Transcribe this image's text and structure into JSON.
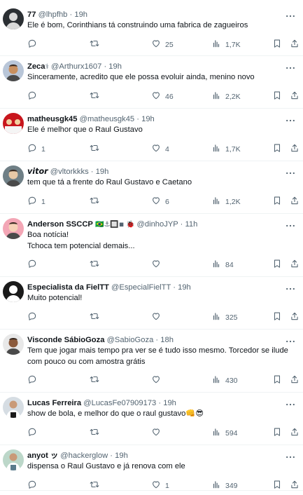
{
  "tweets": [
    {
      "display_name": "77",
      "handle": "@lhpfhb",
      "time": "19h",
      "text_lines": [
        "Ele é bom, Corinthians tá construindo uma fabrica de zagueiros"
      ],
      "replies": "",
      "retweets": "",
      "likes": "25",
      "views": "1,7K"
    },
    {
      "display_name": "Zeca",
      "name_badge": "⚕",
      "handle": "@Arthurx1607",
      "time": "19h",
      "text_lines": [
        "Sinceramente, acredito que ele possa evoluir ainda, menino novo"
      ],
      "replies": "",
      "retweets": "",
      "likes": "46",
      "views": "2,2K"
    },
    {
      "display_name": "matheusgk45",
      "handle": "@matheusgk45",
      "time": "19h",
      "text_lines": [
        "Ele é melhor que o Raul Gustavo"
      ],
      "replies": "1",
      "retweets": "",
      "likes": "4",
      "views": "1,7K"
    },
    {
      "display_name": "𝙫𝙞𝙩𝙤𝙧",
      "handle": "@vltorkkks",
      "time": "19h",
      "text_lines": [
        "tem que tá a frente do Raul Gustavo e Caetano"
      ],
      "replies": "1",
      "retweets": "",
      "likes": "6",
      "views": "1,2K"
    },
    {
      "display_name": "Anderson SSCCP",
      "name_emojis": "🇧🇷⚓🔲◾ 🐞",
      "handle": "@dinhoJYP",
      "time": "11h",
      "text_lines": [
        "Boa notícia!",
        "Tchoca tem potencial demais..."
      ],
      "replies": "",
      "retweets": "",
      "likes": "",
      "views": "84"
    },
    {
      "display_name": "Especialista da FielTT",
      "handle": "@EspecialFielTT",
      "time": "19h",
      "text_lines": [
        "Muito potencial!"
      ],
      "replies": "",
      "retweets": "",
      "likes": "",
      "views": "325"
    },
    {
      "display_name": "Visconde SábioGoza",
      "handle": "@SabioGoza",
      "time": "18h",
      "text_lines": [
        "Tem que jogar mais tempo pra ver se é tudo isso mesmo. Torcedor se ilude",
        "com pouco ou com amostra grátis"
      ],
      "replies": "",
      "retweets": "",
      "likes": "",
      "views": "430"
    },
    {
      "display_name": "Lucas Ferreira",
      "handle": "@LucasFe07909173",
      "time": "19h",
      "text_lines": [
        "show de bola,    e melhor do que o raul gustavo👊😎"
      ],
      "replies": "",
      "retweets": "",
      "likes": "",
      "views": "594"
    },
    {
      "display_name": "anyot ッ",
      "handle": "@hackerglow",
      "time": "19h",
      "text_lines": [
        "dispensa o Raul Gustavo e já renova com ele"
      ],
      "replies": "",
      "retweets": "",
      "likes": "1",
      "views": "349"
    }
  ],
  "icons": {
    "reply": "reply-icon",
    "retweet": "retweet-icon",
    "like": "heart-icon",
    "views": "views-bar-chart-icon",
    "bookmark": "bookmark-icon",
    "share": "share-icon",
    "more": "more-dots-icon"
  },
  "colors": {
    "text": "#0f1419",
    "secondary": "#536471",
    "divider": "#eff3f4"
  }
}
